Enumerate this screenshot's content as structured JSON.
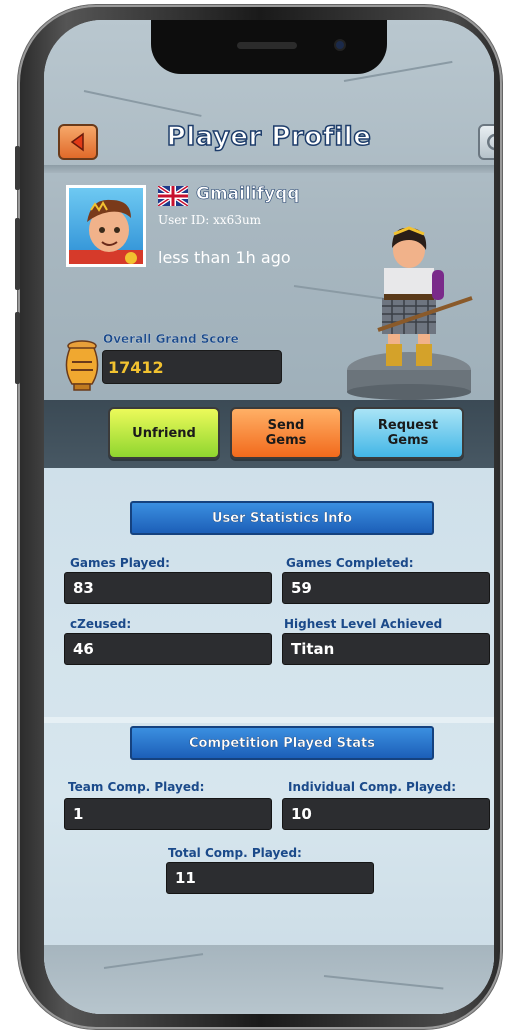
{
  "header": {
    "title": "Player Profile",
    "back_icon": "back-arrow-icon",
    "refresh_icon": "refresh-icon"
  },
  "profile": {
    "username": "Gmailifyqq",
    "user_id": "User ID: xx63um",
    "last_seen": "less than 1h ago",
    "flag_icon": "uk-flag-icon",
    "score_label": "Overall Grand Score",
    "score_value": "17412"
  },
  "actions": {
    "unfriend": "Unfriend",
    "send_gems_line1": "Send",
    "send_gems_line2": "Gems",
    "request_gems_line1": "Request",
    "request_gems_line2": "Gems"
  },
  "user_stats": {
    "header": "User Statistics Info",
    "games_played_label": "Games Played:",
    "games_played_value": "83",
    "games_completed_label": "Games Completed:",
    "games_completed_value": "59",
    "czeused_label": "cZeused:",
    "czeused_value": "46",
    "highest_level_label": "Highest Level Achieved",
    "highest_level_value": "Titan"
  },
  "competition_stats": {
    "header": "Competition Played Stats",
    "team_label": "Team Comp. Played:",
    "team_value": "1",
    "individual_label": "Individual Comp. Played:",
    "individual_value": "10",
    "total_label": "Total Comp. Played:",
    "total_value": "11"
  },
  "colors": {
    "label_blue": "#1b4a8a",
    "score_gold": "#f2c230",
    "unfriend_green": "#8fd62f",
    "send_orange": "#f26a1c",
    "request_blue": "#43b6e6"
  }
}
